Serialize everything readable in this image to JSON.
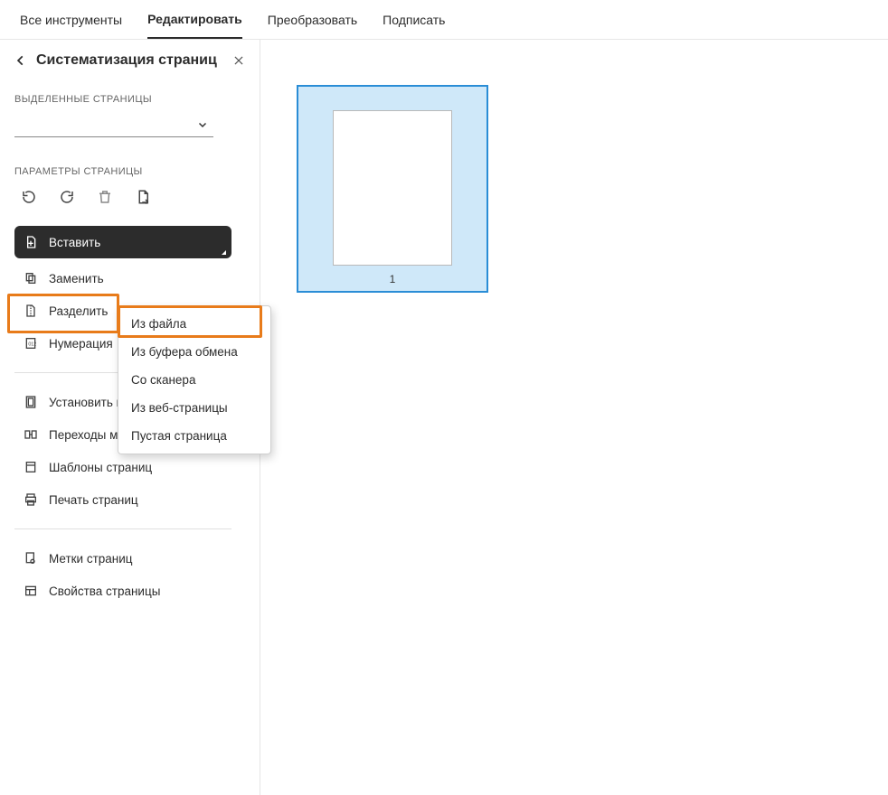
{
  "topbar": {
    "tabs": [
      {
        "label": "Все инструменты"
      },
      {
        "label": "Редактировать"
      },
      {
        "label": "Преобразовать"
      },
      {
        "label": "Подписать"
      }
    ],
    "active_index": 1
  },
  "panel": {
    "title": "Систематизация страниц",
    "section_selected": "ВЫДЕЛЕННЫЕ СТРАНИЦЫ",
    "section_params": "ПАРАМЕТРЫ СТРАНИЦЫ",
    "actions": {
      "insert": "Вставить",
      "replace": "Заменить",
      "split": "Разделить",
      "numbering": "Нумерация"
    },
    "group2": {
      "margins": "Установить поля страницы",
      "transitions": "Переходы между страницами",
      "templates": "Шаблоны страниц",
      "print": "Печать страниц"
    },
    "group3": {
      "labels": "Метки страниц",
      "properties": "Свойства страницы"
    }
  },
  "insert_menu": {
    "from_file": "Из файла",
    "from_clipboard": "Из буфера обмена",
    "from_scanner": "Со сканера",
    "from_web": "Из веб-страницы",
    "blank": "Пустая страница"
  },
  "workspace": {
    "page_number": "1"
  }
}
